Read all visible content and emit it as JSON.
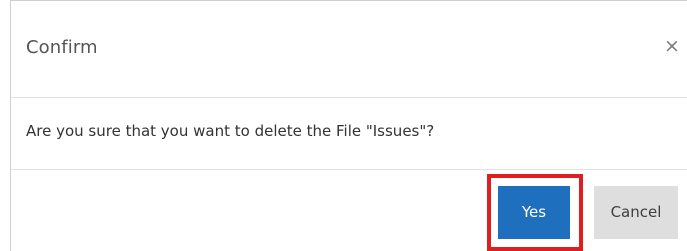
{
  "dialog": {
    "title": "Confirm",
    "close_symbol": "×",
    "message": "Are you sure that you want to delete the File \"Issues\"?",
    "yes_label": "Yes",
    "cancel_label": "Cancel"
  },
  "colors": {
    "primary_button": "#1f6fbf",
    "secondary_button": "#dedede",
    "highlight": "#e01e1e"
  }
}
